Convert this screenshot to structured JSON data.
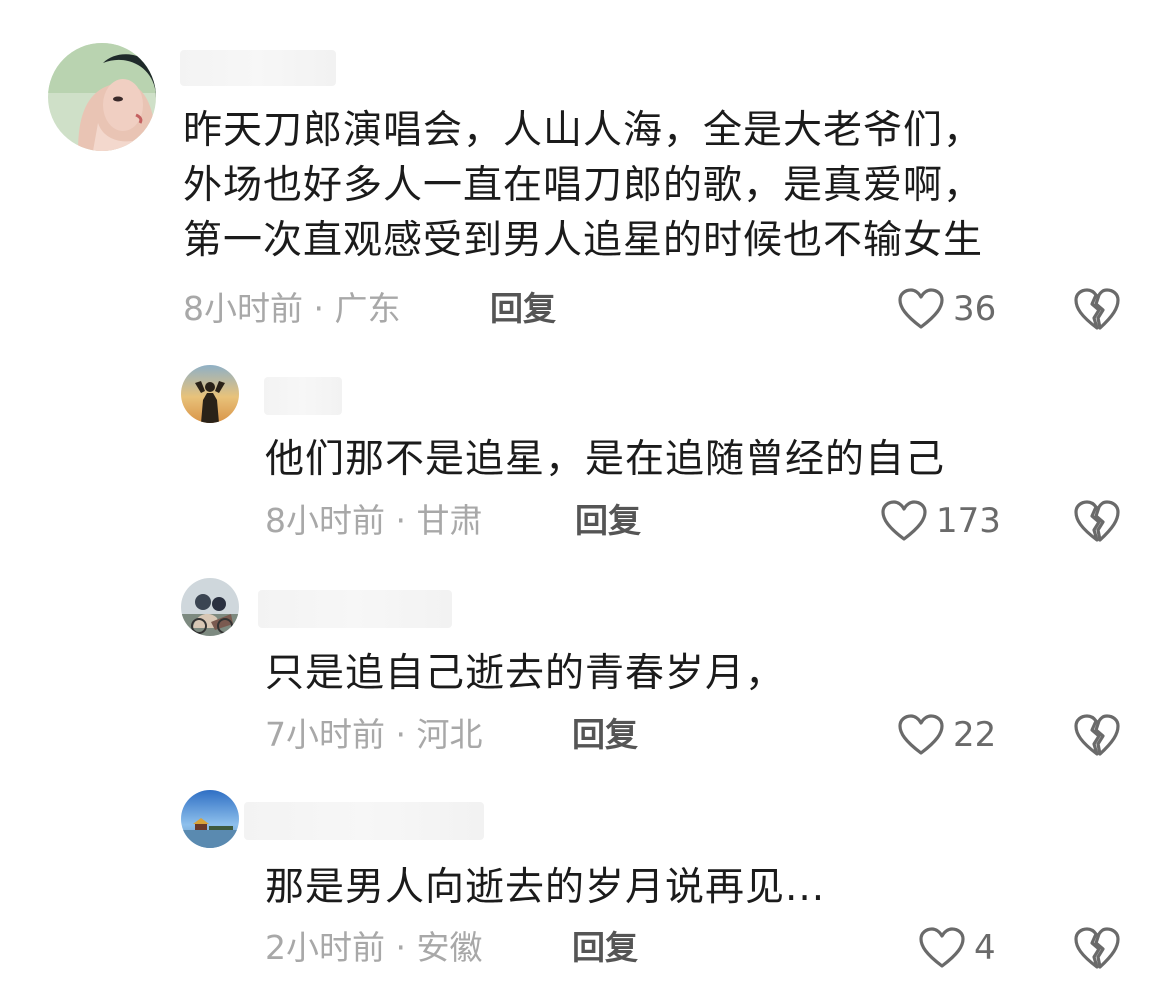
{
  "comments": [
    {
      "text_lines": [
        "昨天刀郎演唱会，人山人海，全是大老爷们，",
        "外场也好多人一直在唱刀郎的歌，是真爱啊，",
        "第一次直观感受到男人追星的时候也不输女生"
      ],
      "meta": "8小时前 · 广东",
      "reply_label": "回复",
      "likes": "36"
    },
    {
      "text_lines": [
        "他们那不是追星，是在追随曾经的自己"
      ],
      "meta": "8小时前 · 甘肃",
      "reply_label": "回复",
      "likes": "173"
    },
    {
      "text_lines": [
        "只是追自己逝去的青春岁月，"
      ],
      "meta": "7小时前 · 河北",
      "reply_label": "回复",
      "likes": "22"
    },
    {
      "text_lines": [
        "那是男人向逝去的岁月说再见..."
      ],
      "meta": "2小时前 · 安徽",
      "reply_label": "回复",
      "likes": "4"
    }
  ],
  "icons": {
    "like": "heart-outline-icon",
    "dislike": "broken-heart-icon"
  },
  "colors": {
    "text": "#1b1b1b",
    "meta": "#a8a8a8",
    "reply": "#555555",
    "icon_stroke": "#6a6a6a"
  }
}
